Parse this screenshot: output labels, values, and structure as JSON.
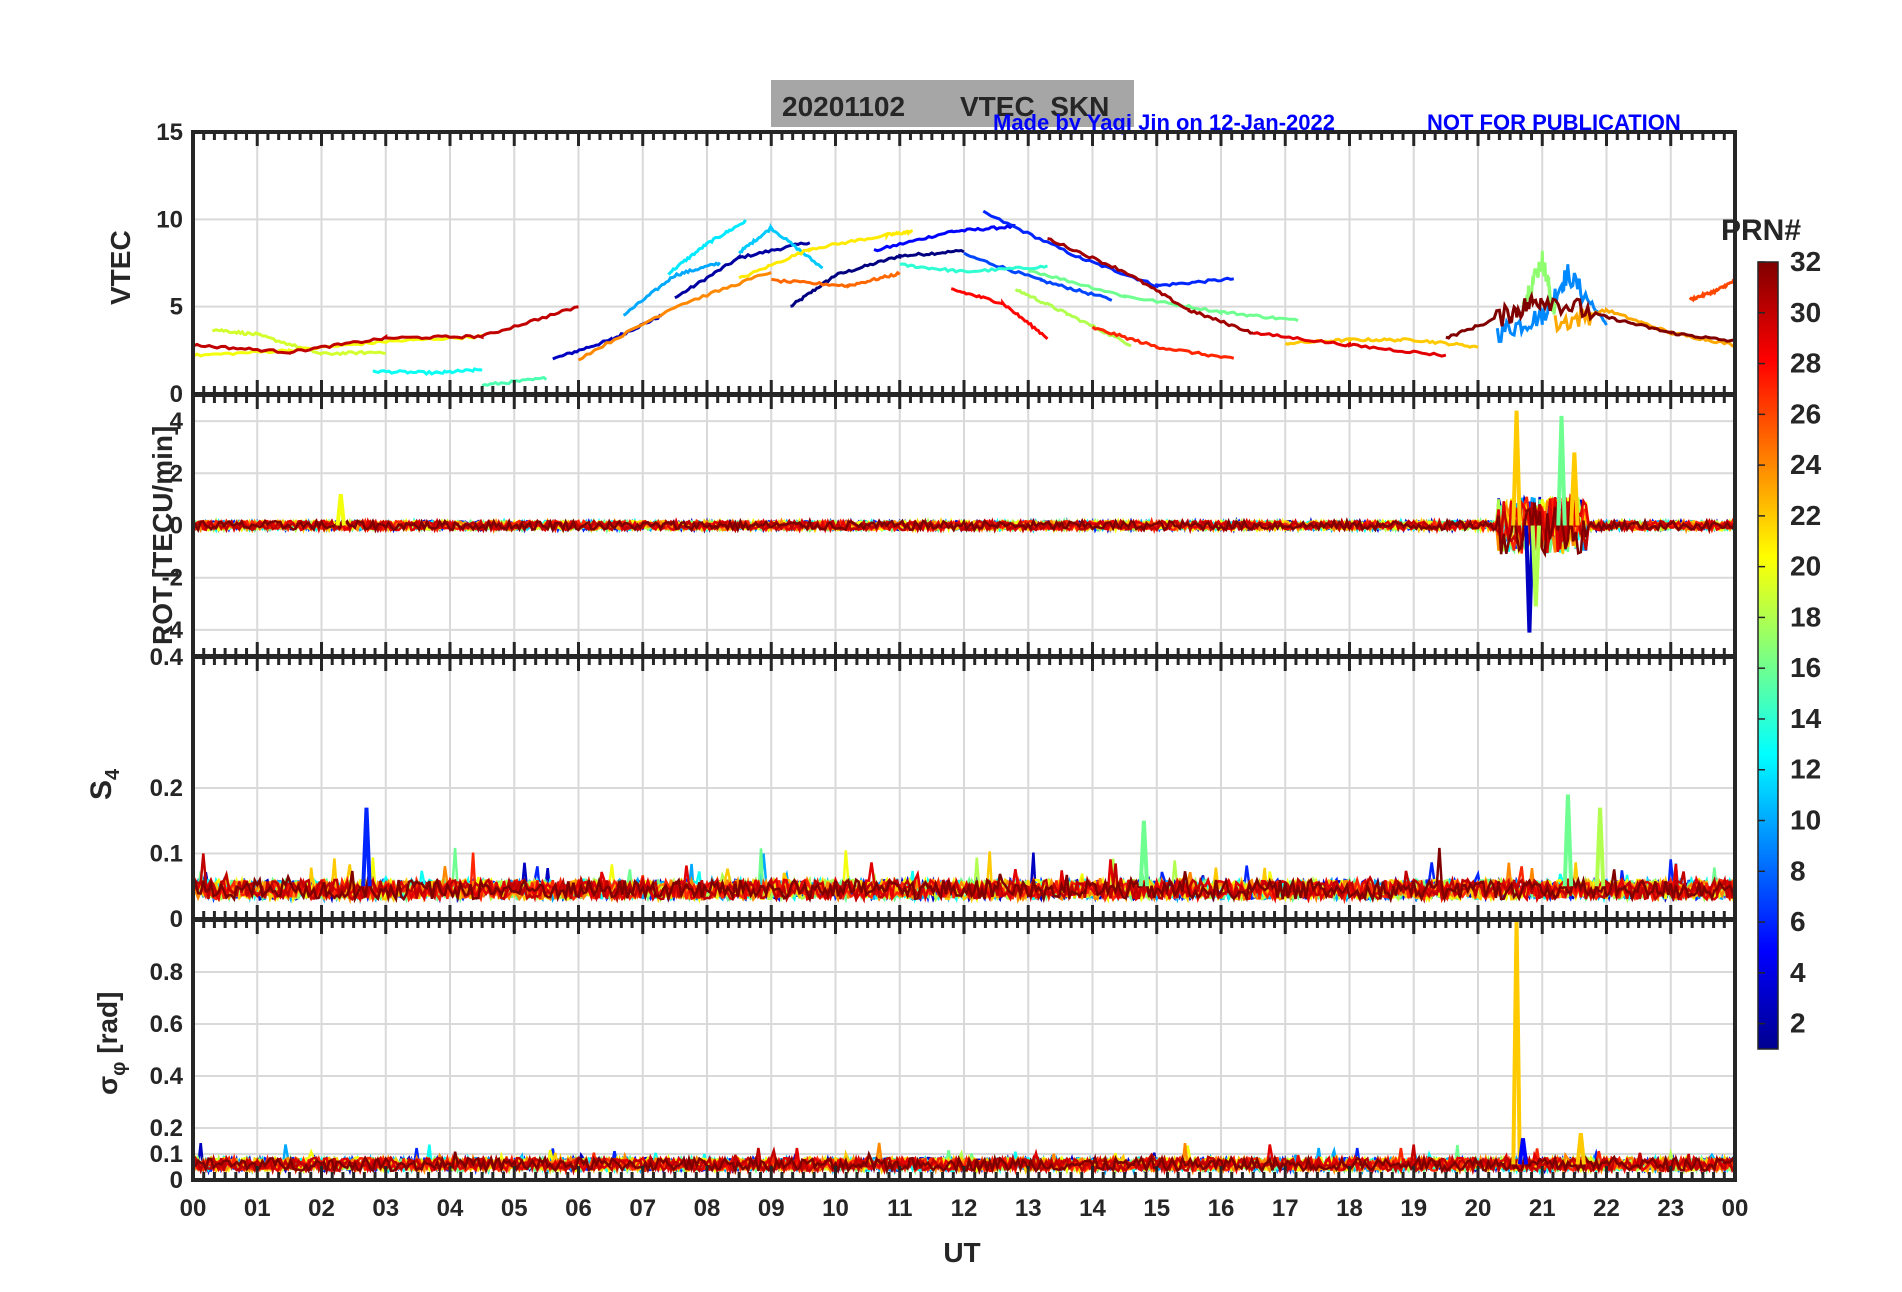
{
  "figure": {
    "title_date": "20201102",
    "title_text": "VTEC  SKN",
    "credit": "Made by Yaqi Jin on 12-Jan-2022",
    "notice": "NOT FOR PUBLICATION",
    "xlabel": "UT",
    "x_ticks": [
      "00",
      "01",
      "02",
      "03",
      "04",
      "05",
      "06",
      "07",
      "08",
      "09",
      "10",
      "11",
      "12",
      "13",
      "14",
      "15",
      "16",
      "17",
      "18",
      "19",
      "20",
      "21",
      "22",
      "23",
      "00"
    ],
    "colorbar": {
      "title": "PRN#",
      "range": [
        1,
        32
      ],
      "ticks": [
        "2",
        "4",
        "6",
        "8",
        "10",
        "12",
        "14",
        "16",
        "18",
        "20",
        "22",
        "24",
        "26",
        "28",
        "30",
        "32"
      ],
      "colormap": "jet"
    },
    "colors": {
      "title_box": "#a6a6a6",
      "credit_text": "#0000ff",
      "axis": "#262626",
      "grid": "#d9d9d9"
    }
  },
  "chart_data": [
    {
      "type": "line",
      "ylabel": "VTEC",
      "ylim": [
        0,
        15
      ],
      "y_ticks": [
        "0",
        "5",
        "10",
        "15"
      ],
      "x_range_hours": [
        0,
        24
      ],
      "grid": true,
      "summary": "Many PRN arcs; VTEC ~2-3 TECU at night, peaking ~8-10 TECU around 09-13 UT, with irregular enhancements near 20-21.5 UT",
      "series": [
        {
          "prn": 1,
          "x": [
            9.3,
            10.0,
            11.0,
            12.0
          ],
          "y": [
            5.0,
            6.8,
            7.9,
            8.2
          ]
        },
        {
          "prn": 2,
          "x": [
            7.5,
            8.5,
            9.6
          ],
          "y": [
            5.5,
            7.8,
            8.7
          ]
        },
        {
          "prn": 3,
          "x": [
            5.6,
            6.5,
            7.3
          ],
          "y": [
            2.0,
            3.1,
            4.5
          ]
        },
        {
          "prn": 5,
          "x": [
            10.6,
            11.8,
            12.8
          ],
          "y": [
            8.2,
            9.3,
            9.6
          ]
        },
        {
          "prn": 6,
          "x": [
            12.3,
            13.8,
            15.0,
            16.2
          ],
          "y": [
            10.4,
            7.8,
            6.2,
            6.6
          ]
        },
        {
          "prn": 7,
          "x": [
            12.0,
            13.2,
            14.3
          ],
          "y": [
            8.0,
            6.5,
            5.4
          ]
        },
        {
          "prn": 9,
          "x": [
            20.3,
            21.0,
            21.4,
            22.0
          ],
          "y": [
            3.5,
            4.5,
            6.9,
            4.0
          ]
        },
        {
          "prn": 10,
          "x": [
            6.7,
            7.5,
            8.2
          ],
          "y": [
            4.5,
            6.8,
            7.5
          ]
        },
        {
          "prn": 11,
          "x": [
            8.5,
            9.0,
            9.8
          ],
          "y": [
            8.1,
            9.5,
            7.2
          ]
        },
        {
          "prn": 12,
          "x": [
            7.4,
            8.0,
            8.6
          ],
          "y": [
            6.9,
            8.6,
            9.9
          ]
        },
        {
          "prn": 13,
          "x": [
            2.8,
            3.8,
            4.5
          ],
          "y": [
            1.3,
            1.2,
            1.4
          ]
        },
        {
          "prn": 14,
          "x": [
            11.0,
            12.0,
            13.3
          ],
          "y": [
            7.4,
            7.0,
            7.3
          ]
        },
        {
          "prn": 15,
          "x": [
            4.5,
            5.5
          ],
          "y": [
            0.5,
            0.9
          ]
        },
        {
          "prn": 16,
          "x": [
            13.0,
            14.5,
            16.0,
            17.2
          ],
          "y": [
            7.1,
            5.6,
            4.7,
            4.2
          ]
        },
        {
          "prn": 17,
          "x": [
            20.7,
            21.0,
            21.2
          ],
          "y": [
            5.2,
            7.7,
            4.6
          ]
        },
        {
          "prn": 18,
          "x": [
            12.8,
            13.6,
            14.6
          ],
          "y": [
            6.0,
            4.6,
            2.8
          ]
        },
        {
          "prn": 19,
          "x": [
            0.3,
            1.0,
            2.0,
            3.0
          ],
          "y": [
            3.7,
            3.4,
            2.3,
            2.4
          ]
        },
        {
          "prn": 20,
          "x": [
            0.0,
            1.5,
            3.0,
            4.5
          ],
          "y": [
            2.2,
            2.5,
            3.0,
            3.3
          ]
        },
        {
          "prn": 21,
          "x": [
            8.5,
            9.6,
            10.8,
            11.2
          ],
          "y": [
            6.6,
            8.3,
            9.1,
            9.3
          ]
        },
        {
          "prn": 22,
          "x": [
            17.0,
            18.0,
            19.0,
            20.0
          ],
          "y": [
            2.9,
            3.1,
            3.1,
            2.7
          ]
        },
        {
          "prn": 23,
          "x": [
            21.2,
            22.0,
            23.0,
            24.0
          ],
          "y": [
            4.0,
            4.8,
            3.5,
            2.8
          ]
        },
        {
          "prn": 24,
          "x": [
            6.0,
            7.5,
            9.0
          ],
          "y": [
            2.0,
            5.0,
            7.0
          ]
        },
        {
          "prn": 25,
          "x": [
            9.0,
            10.2,
            11.0
          ],
          "y": [
            6.5,
            6.2,
            6.9
          ]
        },
        {
          "prn": 26,
          "x": [
            23.3,
            23.7,
            24.0
          ],
          "y": [
            5.4,
            5.9,
            6.5
          ]
        },
        {
          "prn": 27,
          "x": [
            14.0,
            15.0,
            16.2
          ],
          "y": [
            3.8,
            2.7,
            2.0
          ]
        },
        {
          "prn": 28,
          "x": [
            11.8,
            12.6,
            13.3
          ],
          "y": [
            6.0,
            5.2,
            3.2
          ]
        },
        {
          "prn": 29,
          "x": [
            16.5,
            18.0,
            19.5
          ],
          "y": [
            3.5,
            2.8,
            2.2
          ]
        },
        {
          "prn": 30,
          "x": [
            0.0,
            1.5,
            3.0,
            4.5,
            6.0
          ],
          "y": [
            2.8,
            2.4,
            3.2,
            3.3,
            5.0
          ]
        },
        {
          "prn": 31,
          "x": [
            13.3,
            14.5,
            15.5,
            16.5
          ],
          "y": [
            8.9,
            7.0,
            4.8,
            3.5
          ]
        },
        {
          "prn": 32,
          "x": [
            19.5,
            20.5,
            21.0,
            22.0,
            23.0,
            24.0
          ],
          "y": [
            3.2,
            4.6,
            5.5,
            4.4,
            3.5,
            3.0
          ]
        }
      ]
    },
    {
      "type": "line",
      "ylabel": "ROT [TECU/min]",
      "ylim": [
        -5,
        5
      ],
      "y_ticks": [
        "-4",
        "-2",
        "0",
        "2",
        "4"
      ],
      "grid": true,
      "summary": "ROT near 0 all day (|ROT| < 0.5) except strong fluctuations of up to about +/-4 TECU/min between ~20.5 and 21.6 UT; isolated spike ~1.2 at 02.3 UT",
      "spikes": [
        {
          "prn": 20,
          "x": 2.3,
          "y": 1.2
        },
        {
          "prn": 22,
          "x": 20.6,
          "y": 4.4
        },
        {
          "prn": 3,
          "x": 20.8,
          "y": -4.1
        },
        {
          "prn": 16,
          "x": 21.3,
          "y": 4.2
        },
        {
          "prn": 18,
          "x": 20.9,
          "y": -3.1
        },
        {
          "prn": 22,
          "x": 21.5,
          "y": 2.8
        }
      ]
    },
    {
      "type": "line",
      "ylabel": "S4",
      "ylim": [
        0,
        0.4
      ],
      "y_ticks": [
        "0",
        "0.1",
        "0.2",
        "0.4"
      ],
      "grid": true,
      "summary": "Amplitude scintillation S4 between ~0.03 and 0.1 throughout; occasional spikes up to ~0.17-0.19",
      "spikes": [
        {
          "prn": 6,
          "x": 2.7,
          "y": 0.17
        },
        {
          "prn": 16,
          "x": 21.4,
          "y": 0.19
        },
        {
          "prn": 18,
          "x": 21.9,
          "y": 0.17
        },
        {
          "prn": 16,
          "x": 14.8,
          "y": 0.15
        }
      ]
    },
    {
      "type": "line",
      "ylabel": "σ_φ [rad]",
      "ylim": [
        0,
        1
      ],
      "y_ticks": [
        "0",
        "0.1",
        "0.2",
        "0.4",
        "0.6",
        "0.8"
      ],
      "grid": true,
      "summary": "Phase scintillation mostly 0.03-0.12 rad; one PRN 22 burst reaching ~1.0 rad near 20.6 UT",
      "spikes": [
        {
          "prn": 22,
          "x": 20.6,
          "y": 1.0
        },
        {
          "prn": 22,
          "x": 21.6,
          "y": 0.18
        },
        {
          "prn": 5,
          "x": 20.7,
          "y": 0.16
        }
      ]
    }
  ]
}
